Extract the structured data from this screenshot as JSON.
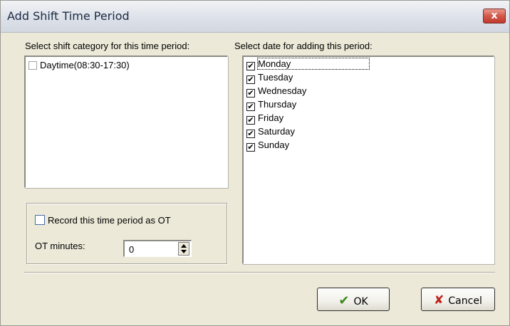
{
  "window": {
    "title": "Add Shift Time Period",
    "close_glyph": "x"
  },
  "category": {
    "label": "Select shift category for this time period:",
    "items": [
      {
        "label": "Daytime(08:30-17:30)",
        "checked": false
      }
    ]
  },
  "dates": {
    "label": "Select date for adding this period:",
    "items": [
      {
        "label": "Monday",
        "checked": true
      },
      {
        "label": "Tuesday",
        "checked": true
      },
      {
        "label": "Wednesday",
        "checked": true
      },
      {
        "label": "Thursday",
        "checked": true
      },
      {
        "label": "Friday",
        "checked": true
      },
      {
        "label": "Saturday",
        "checked": true
      },
      {
        "label": "Sunday",
        "checked": true
      }
    ]
  },
  "ot": {
    "record_label": "Record this time period as OT",
    "record_checked": false,
    "minutes_label": "OT minutes:",
    "minutes_value": "0"
  },
  "buttons": {
    "ok_label": "OK",
    "cancel_label": "Cancel",
    "ok_icon": "check-icon",
    "cancel_icon": "x-icon"
  },
  "check_glyph": "✔"
}
